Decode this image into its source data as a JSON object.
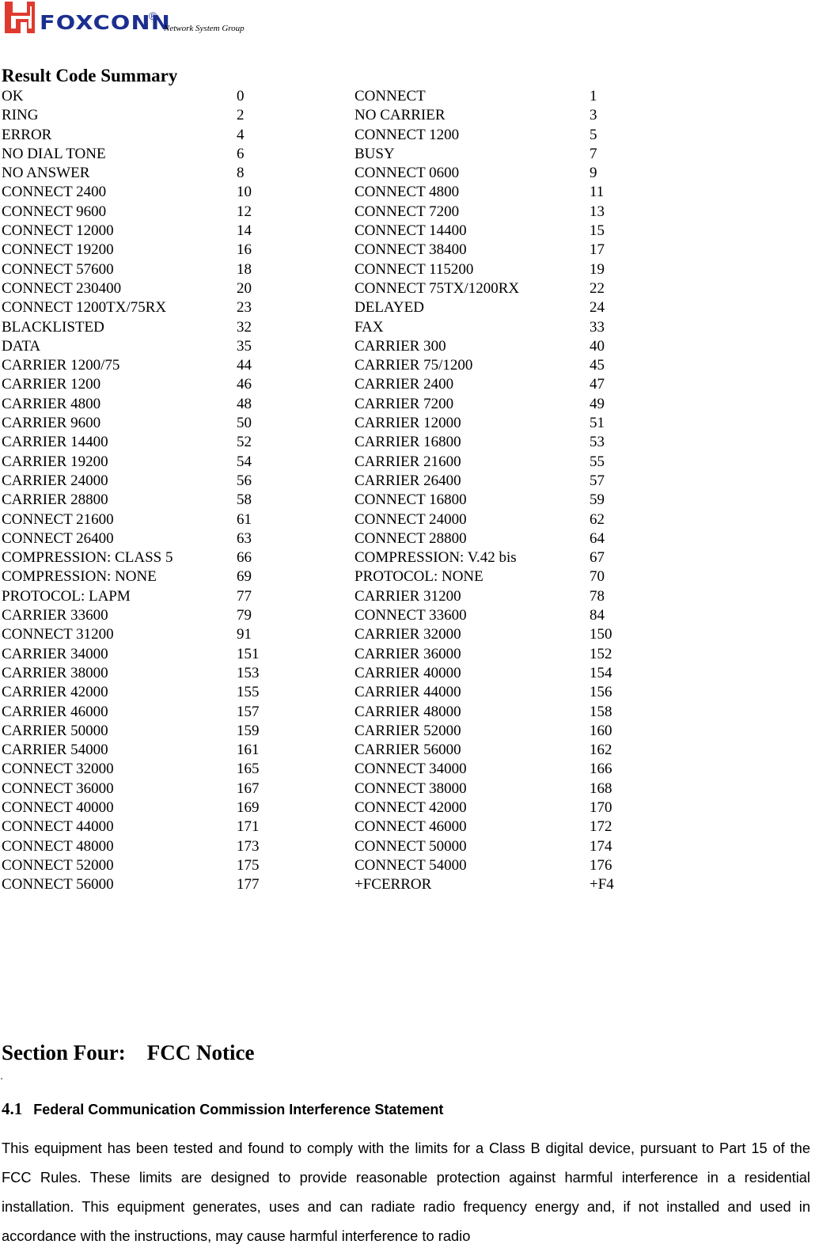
{
  "header": {
    "logo_word": "FOXCONN",
    "logo_registered": "®",
    "logo_tagline": "Network System Group",
    "brand_colors": {
      "mark_red": "#e03a2e",
      "word_blue": "#1c2f8f"
    }
  },
  "result_codes": {
    "title": "Result Code Summary",
    "rows": [
      [
        "OK",
        "0",
        "CONNECT",
        "1"
      ],
      [
        "RING",
        "2",
        "NO CARRIER",
        "3"
      ],
      [
        "ERROR",
        "4",
        "CONNECT 1200",
        "5"
      ],
      [
        "NO DIAL TONE",
        "6",
        "BUSY",
        "7"
      ],
      [
        "NO ANSWER",
        "8",
        "CONNECT 0600",
        "9"
      ],
      [
        "CONNECT 2400",
        "10",
        "CONNECT 4800",
        "11"
      ],
      [
        "CONNECT 9600",
        "12",
        "CONNECT 7200",
        "13"
      ],
      [
        "CONNECT 12000",
        "14",
        "CONNECT 14400",
        "15"
      ],
      [
        "CONNECT 19200",
        "16",
        "CONNECT 38400",
        "17"
      ],
      [
        "CONNECT 57600",
        "18",
        "CONNECT 115200",
        "19"
      ],
      [
        "CONNECT 230400",
        "20",
        "CONNECT 75TX/1200RX",
        "22"
      ],
      [
        "CONNECT 1200TX/75RX",
        "23",
        "DELAYED",
        "24"
      ],
      [
        "BLACKLISTED",
        "32",
        "FAX",
        "33"
      ],
      [
        "DATA",
        "35",
        "CARRIER 300",
        "40"
      ],
      [
        "CARRIER 1200/75",
        "44",
        "CARRIER 75/1200",
        "45"
      ],
      [
        "CARRIER 1200",
        "46",
        "CARRIER 2400",
        "47"
      ],
      [
        "CARRIER 4800",
        "48",
        "CARRIER 7200",
        "49"
      ],
      [
        "CARRIER 9600",
        "50",
        "CARRIER 12000",
        "51"
      ],
      [
        "CARRIER 14400",
        "52",
        "CARRIER 16800",
        "53"
      ],
      [
        "CARRIER 19200",
        "54",
        "CARRIER 21600",
        "55"
      ],
      [
        "CARRIER 24000",
        "56",
        "CARRIER 26400",
        "57"
      ],
      [
        "CARRIER 28800",
        "58",
        "CONNECT 16800",
        "59"
      ],
      [
        "CONNECT 21600",
        "61",
        "CONNECT 24000",
        "62"
      ],
      [
        "CONNECT 26400",
        "63",
        "CONNECT 28800",
        "64"
      ],
      [
        "COMPRESSION: CLASS 5",
        "66",
        "COMPRESSION: V.42 bis",
        "67"
      ],
      [
        "COMPRESSION: NONE",
        "69",
        "PROTOCOL: NONE",
        "70"
      ],
      [
        "PROTOCOL: LAPM",
        "77",
        "CARRIER 31200",
        "78"
      ],
      [
        "CARRIER 33600",
        "79",
        "CONNECT 33600",
        "84"
      ],
      [
        "CONNECT 31200",
        "91",
        "CARRIER 32000",
        "150"
      ],
      [
        "CARRIER 34000",
        "151",
        "CARRIER 36000",
        "152"
      ],
      [
        "CARRIER 38000",
        "153",
        "CARRIER 40000",
        "154"
      ],
      [
        "CARRIER 42000",
        "155",
        "CARRIER 44000",
        "156"
      ],
      [
        "CARRIER 46000",
        "157",
        "CARRIER 48000",
        "158"
      ],
      [
        "CARRIER 50000",
        "159",
        "CARRIER 52000",
        "160"
      ],
      [
        "CARRIER 54000",
        "161",
        "CARRIER 56000",
        "162"
      ],
      [
        "CONNECT 32000",
        "165",
        "CONNECT 34000",
        "166"
      ],
      [
        "CONNECT 36000",
        "167",
        "CONNECT 38000",
        "168"
      ],
      [
        "CONNECT 40000",
        "169",
        "CONNECT 42000",
        "170"
      ],
      [
        "CONNECT 44000",
        "171",
        "CONNECT 46000",
        "172"
      ],
      [
        "CONNECT 48000",
        "173",
        "CONNECT 50000",
        "174"
      ],
      [
        "CONNECT 52000",
        "175",
        "CONNECT 54000",
        "176"
      ],
      [
        "CONNECT 56000",
        "177",
        "+FCERROR",
        "+F4"
      ]
    ]
  },
  "section": {
    "title": "Section Four:    FCC Notice",
    "subsection_number": "4.1",
    "subsection_title": "Federal Communication Commission Interference Statement",
    "paragraph": "This equipment has been tested and found to comply with the limits for a Class B digital device, pursuant to Part 15 of the FCC Rules.  These limits are designed to provide reasonable protection against harmful interference in a residential installation.  This equipment generates, uses and can radiate radio frequency energy and, if not installed and used in accordance with the instructions, may cause harmful interference to radio"
  }
}
